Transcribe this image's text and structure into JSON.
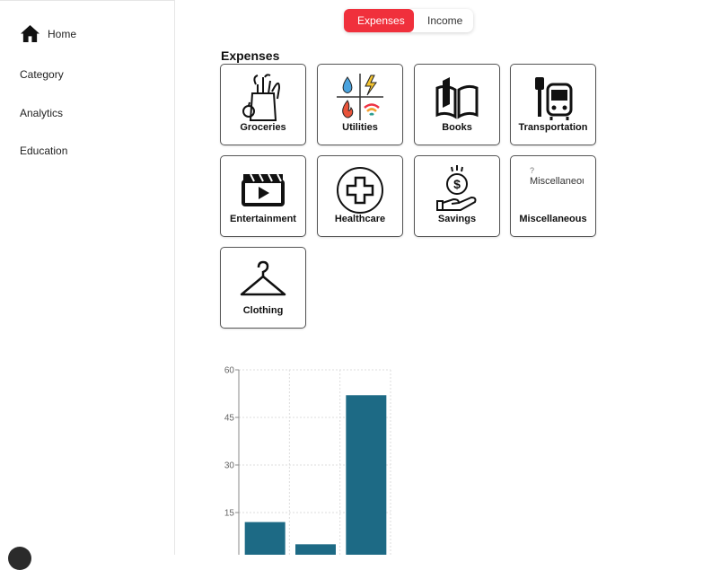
{
  "sidebar": {
    "items": [
      {
        "label": "Home",
        "icon": "home-icon"
      },
      {
        "label": "Category"
      },
      {
        "label": "Analytics"
      },
      {
        "label": "Education"
      }
    ]
  },
  "toggle": {
    "expenses_label": "Expenses",
    "income_label": "Income",
    "active": "Expenses",
    "active_color": "#f0303c"
  },
  "main": {
    "section_title": "Expenses",
    "categories": [
      {
        "label": "Groceries",
        "icon": "groceries-icon"
      },
      {
        "label": "Utilities",
        "icon": "utilities-icon"
      },
      {
        "label": "Books",
        "icon": "books-icon"
      },
      {
        "label": "Transportation",
        "icon": "transportation-icon"
      },
      {
        "label": "Entertainment",
        "icon": "entertainment-icon"
      },
      {
        "label": "Healthcare",
        "icon": "healthcare-icon"
      },
      {
        "label": "Savings",
        "icon": "savings-icon"
      },
      {
        "label": "Miscellaneous",
        "icon": "broken-image-icon",
        "image_alt": "Miscellaneous"
      },
      {
        "label": "Clothing",
        "icon": "hanger-icon"
      }
    ]
  },
  "chart_data": {
    "type": "bar",
    "values": [
      12,
      5,
      52
    ],
    "ylim": [
      0,
      60
    ],
    "yticks": [
      15,
      30,
      45,
      60
    ],
    "grid": true,
    "bar_color": "#1d6a85"
  }
}
